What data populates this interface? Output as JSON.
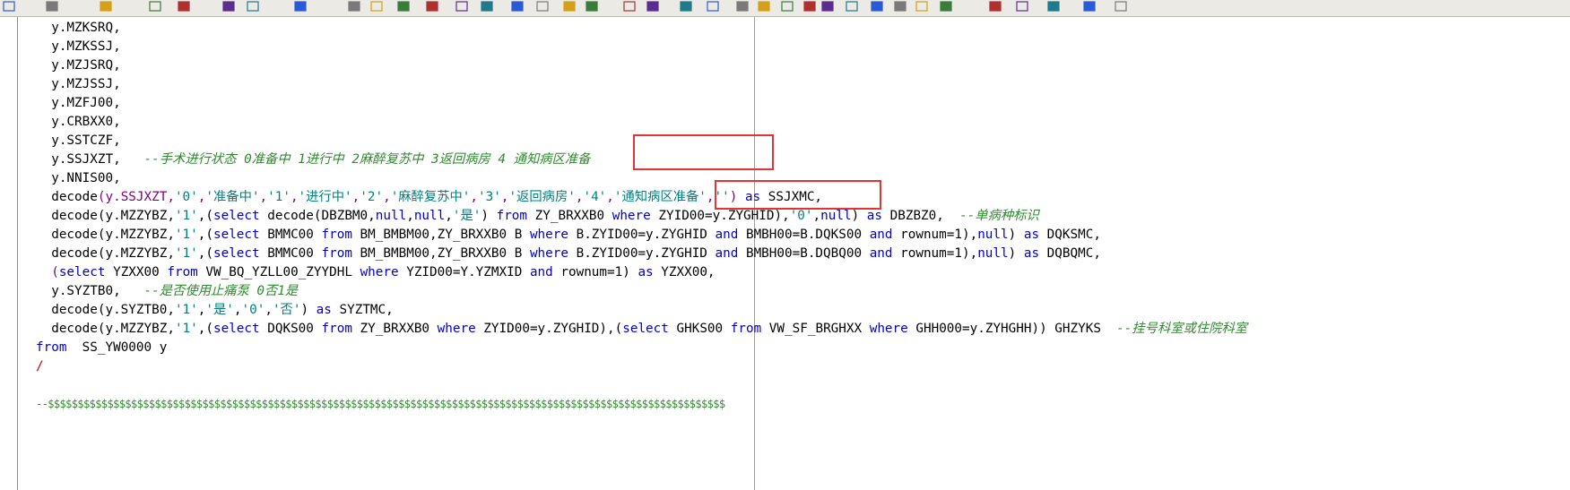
{
  "colors": {
    "keyword": "#0000cc",
    "string": "#008080",
    "comment": "#2e8b2e",
    "highlight_box": "#e53333",
    "toolbar_bg": "#eceae4"
  },
  "toolbar": {
    "icons": [
      "arrow-right-icon",
      "new-file-icon",
      "open-file-icon",
      "save-icon",
      "print-icon",
      "text-ab-icon",
      "grid-icon",
      "explain-icon",
      "pin-icon",
      "asterisk-icon",
      "window-icon",
      "toggle-icon",
      "db-icon",
      "db-split-icon",
      "key-icon",
      "find-icon",
      "compare-icon",
      "tool-icon",
      "first-icon",
      "prev-icon",
      "play-icon",
      "step-icon",
      "pause-icon",
      "stop-icon",
      "next-icon",
      "last-icon",
      "no-icon",
      "copy-icon",
      "exec1-icon",
      "exec2-icon",
      "exec3-icon",
      "exec4-icon",
      "bulb-icon",
      "report-icon",
      "wand-icon",
      "window2-icon",
      "db2-icon"
    ]
  },
  "code": {
    "l1": "  y.MZKSRQ,",
    "l2": "  y.MZKSSJ,",
    "l3": "  y.MZJSRQ,",
    "l4": "  y.MZJSSJ,",
    "l5": "  y.MZFJ00,",
    "l6": "  y.CRBXX0,",
    "l7": "  y.SSTCZF,",
    "l8_code": "  y.SSJXZT,   ",
    "l8_comment": "--手术进行状态 0准备中 1进行中 2麻醉复苏中 3返回病房 4 通知病区准备",
    "l9": "  y.NNIS00,",
    "l10_a": "  decode",
    "l10_b": "(y.SSJXZT,",
    "l10_s1": "'0'",
    "l10_c1": ",",
    "l10_s2": "'准备中'",
    "l10_c2": ",",
    "l10_s3": "'1'",
    "l10_c3": ",",
    "l10_s4": "'进行中'",
    "l10_c4": ",",
    "l10_s5": "'2'",
    "l10_c5": ",",
    "l10_s6": "'麻醉复苏中'",
    "l10_c6": ",",
    "l10_s7": "'3'",
    "l10_c7": ",",
    "l10_s8": "'返回病房'",
    "l10_c8": ",",
    "l10_s9": "'4'",
    "l10_c9": ",",
    "l10_s10": "'通知病区准备'",
    "l10_c10": ",",
    "l10_s11": "''",
    "l10_c11": ") ",
    "l10_kw": "as",
    "l10_end": " SSJXMC,",
    "l11_code_a": "  decode(y.MZZYBZ,",
    "l11_s1": "'1'",
    "l11_code_b": ",(",
    "l11_kw1": "select",
    "l11_code_c": " decode(DBZBM0,",
    "l11_kw2": "null",
    "l11_c2": ",",
    "l11_kw3": "null",
    "l11_c3": ",",
    "l11_s2": "'是'",
    "l11_code_d": ") ",
    "l11_kw4": "from",
    "l11_code_e": " ZY_BRXXB0 ",
    "l11_kw5": "where",
    "l11_code_f": " ZYID00=y.ZYGHID),",
    "l11_s3": "'0'",
    "l11_c4": ",",
    "l11_kw6": "null",
    "l11_code_g": ") ",
    "l11_kw7": "as",
    "l11_code_h": " DBZBZ0,  ",
    "l11_comment": "--单病种标识",
    "l12_code_a": "  decode(y.MZZYBZ,",
    "l12_s1": "'1'",
    "l12_code_b": ",(",
    "l12_kw1": "select",
    "l12_code_c": " BMMC00 ",
    "l12_kw2": "from",
    "l12_code_d": " BM_BMBM00,ZY_BRXXB0 B ",
    "l12_kw3": "where",
    "l12_code_e": " B.ZYID00=y.ZYGHID ",
    "l12_kw4": "and",
    "l12_code_f": " BMBH00=B.DQKS00 ",
    "l12_kw5": "and",
    "l12_code_g": " rownum=1),",
    "l12_kw6": "null",
    "l12_code_h": ") ",
    "l12_kw7": "as",
    "l12_code_i": " DQKSMC,",
    "l13_code_a": "  decode(y.MZZYBZ,",
    "l13_s1": "'1'",
    "l13_code_b": ",(",
    "l13_kw1": "select",
    "l13_code_c": " BMMC00 ",
    "l13_kw2": "from",
    "l13_code_d": " BM_BMBM00,ZY_BRXXB0 B ",
    "l13_kw3": "where",
    "l13_code_e": " B.ZYID00=y.ZYGHID ",
    "l13_kw4": "and",
    "l13_code_f": " BMBH00=B.DQBQ00 ",
    "l13_kw5": "and",
    "l13_code_g": " rownum=1),",
    "l13_kw6": "null",
    "l13_code_h": ") ",
    "l13_kw7": "as",
    "l13_code_i": " DQBQMC,",
    "l14_a": "  (",
    "l14_kw1": "select",
    "l14_b": " YZXX00 ",
    "l14_kw2": "from",
    "l14_c": " VW_BQ_YZLL00_ZYYDHL ",
    "l14_kw3": "where",
    "l14_d": " YZID00=Y.YZMXID ",
    "l14_kw4": "and",
    "l14_e": " rownum=1) ",
    "l14_kw5": "as",
    "l14_f": " YZXX00,",
    "l15_code": "  y.SYZTB0,   ",
    "l15_comment": "--是否使用止痛泵 0否1是",
    "l16_a": "  decode(y.SYZTB0,",
    "l16_s1": "'1'",
    "l16_c1": ",",
    "l16_s2": "'是'",
    "l16_c2": ",",
    "l16_s3": "'0'",
    "l16_c3": ",",
    "l16_s4": "'否'",
    "l16_c4": ") ",
    "l16_kw": "as",
    "l16_end": " SYZTMC,",
    "l17_a": "  decode(y.MZZYBZ,",
    "l17_s1": "'1'",
    "l17_b": ",(",
    "l17_kw1": "select",
    "l17_c": " DQKS00 ",
    "l17_kw2": "from",
    "l17_d": " ZY_BRXXB0 ",
    "l17_kw3": "where",
    "l17_e": " ZYID00=y.ZYGHID),(",
    "l17_kw4": "select",
    "l17_f": " GHKS00 ",
    "l17_kw5": "from",
    "l17_g": " VW_SF_BRGHXX ",
    "l17_kw6": "where",
    "l17_h": " GHH000=y.ZYHGHH)) GHZYKS  ",
    "l17_comment": "--挂号科室或住院科室",
    "l18_kw": "from",
    "l18_rest": "  SS_YW0000 y",
    "l19": "/",
    "l21": "--$$$$$$$$$$$$$$$$$$$$$$$$$$$$$$$$$$$$$$$$$$$$$$$$$$$$$$$$$$$$$$$$$$$$$$$$$$$$$$$$$$$$$$$$$$$$$$$$$$$$$$$$$$$$$$$$$$"
  }
}
